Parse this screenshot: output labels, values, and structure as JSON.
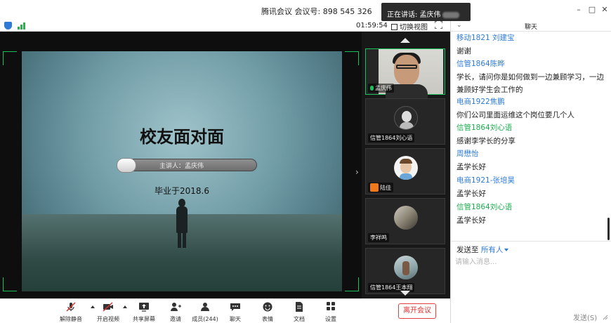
{
  "window": {
    "title": "腾讯会议 会议号: 898 545 326",
    "speaking_prefix": "正在讲话: 孟庆伟"
  },
  "status": {
    "timer": "01:59:54",
    "switch_view": "切换视图"
  },
  "slide": {
    "title": "校友面对面",
    "speaker": "主讲人：孟庆伟",
    "graduated": "毕业于2018.6"
  },
  "participants": [
    {
      "name": "孟庆伟",
      "mic": "on",
      "active": true
    },
    {
      "name": "信管1864刘心语",
      "mic": "off"
    },
    {
      "name": "陆佳",
      "mic": "off"
    },
    {
      "name": "李祥鸣",
      "mic": "off"
    },
    {
      "name": "信管1864王本翔",
      "mic": "off"
    }
  ],
  "toolbar": {
    "mute": "解除静音",
    "video": "开启视频",
    "share": "共享屏幕",
    "invite": "邀请",
    "members": "成员(244)",
    "chat": "聊天",
    "emoji": "表情",
    "docs": "文档",
    "apps": "设置",
    "leave": "离开会议"
  },
  "chat": {
    "title": "聊天",
    "messages": [
      {
        "sender": "移动1821 刘建宝",
        "sender_color": "#2e7bd6",
        "text": "谢谢"
      },
      {
        "sender": "信管1864陈晔",
        "sender_color": "#2e7bd6",
        "text": "学长，请问你是如何做到一边兼顾学习，一边兼顾好学生会工作的"
      },
      {
        "sender": "电商1922焦鹏",
        "sender_color": "#2e7bd6",
        "text": "你们公司里面运维这个岗位要几个人"
      },
      {
        "sender": "信管1864刘心语",
        "sender_color": "#1bae4e",
        "text": "感谢李学长的分享"
      },
      {
        "sender": "周懋怡",
        "sender_color": "#2e7bd6",
        "text": "孟学长好"
      },
      {
        "sender": "电商1921-张培昊",
        "sender_color": "#2e7bd6",
        "text": "孟学长好"
      },
      {
        "sender": "信管1864刘心语",
        "sender_color": "#1bae4e",
        "text": "孟学长好"
      }
    ],
    "send_to_label": "发送至",
    "send_to_target": "所有人",
    "input_placeholder": "请输入消息...",
    "send_button": "发送(S)"
  }
}
